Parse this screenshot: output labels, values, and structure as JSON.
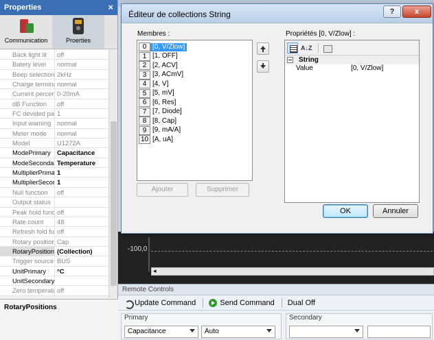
{
  "properties_panel": {
    "title": "Properties",
    "close_glyph": "×",
    "tabs": [
      {
        "label": "Communication",
        "icon": "communication-icon"
      },
      {
        "label": "Proerties",
        "icon": "multimeter-icon"
      }
    ],
    "rows": [
      {
        "key": "Back light lit",
        "value": "off"
      },
      {
        "key": "Batery level",
        "value": "normal"
      },
      {
        "key": "Beep selection",
        "value": "2kHz"
      },
      {
        "key": "Charge terminal",
        "value": "normal"
      },
      {
        "key": "Current percent",
        "value": "0-20mA"
      },
      {
        "key": "dB Function",
        "value": "off"
      },
      {
        "key": "FC devided pa",
        "value": "1"
      },
      {
        "key": "Input warning",
        "value": "normal"
      },
      {
        "key": "Meter mode",
        "value": "normal"
      },
      {
        "key": "Model",
        "value": "U1272A"
      },
      {
        "key": "ModePrimary",
        "value": "Capacitance"
      },
      {
        "key": "ModeSecondary",
        "value": "Temperature"
      },
      {
        "key": "MultiplierPrimary",
        "value": "1"
      },
      {
        "key": "MultiplierSecondary",
        "value": "1"
      },
      {
        "key": "Null function",
        "value": "off"
      },
      {
        "key": "Output status",
        "value": ""
      },
      {
        "key": "Peak hold func",
        "value": "off"
      },
      {
        "key": "Rate count",
        "value": "48"
      },
      {
        "key": "Refresh fold func",
        "value": "off"
      },
      {
        "key": "Rotary position",
        "value": "Cap"
      },
      {
        "key": "RotaryPositions",
        "value": "(Collection)"
      },
      {
        "key": "Trigger source",
        "value": "BUS"
      },
      {
        "key": "UnitPrimary",
        "value": "°C"
      },
      {
        "key": "UnitSecondary",
        "value": ""
      },
      {
        "key": "Zero temperature",
        "value": "off"
      }
    ],
    "description_title": "RotaryPositions"
  },
  "chart": {
    "axis_label": "-100,0",
    "secondary_label": "Secondary"
  },
  "remote_controls": {
    "header": "Remote Controls",
    "update_label": "Update Command",
    "send_label": "Send Command",
    "dual_off_label": "Dual Off",
    "primary_group": "Primary",
    "secondary_group": "Secondary",
    "primary_mode": "Capacitance",
    "primary_range": "Auto",
    "secondary_mode": "",
    "secondary_range": ""
  },
  "dialog": {
    "title": "Éditeur de collections String",
    "help_glyph": "?",
    "close_glyph": "x",
    "members_label": "Membres :",
    "members": [
      {
        "index": "0",
        "text": "[0, V/Zlow]"
      },
      {
        "index": "1",
        "text": "[1, OFF]"
      },
      {
        "index": "2",
        "text": "[2, ACV]"
      },
      {
        "index": "3",
        "text": "[3, ACmV]"
      },
      {
        "index": "4",
        "text": "[4, V]"
      },
      {
        "index": "5",
        "text": "[5, mV]"
      },
      {
        "index": "6",
        "text": "[6, Res]"
      },
      {
        "index": "7",
        "text": "[7, Diode]"
      },
      {
        "index": "8",
        "text": "[8, Cap]"
      },
      {
        "index": "9",
        "text": "[9, mA/A]"
      },
      {
        "index": "10",
        "text": "[A, uA]"
      }
    ],
    "add_label": "Ajouter",
    "remove_label": "Supprimer",
    "properties_label": "Propriétés [0, V/Zlow] :",
    "category": "String",
    "value_key": "Value",
    "value_val": "[0, V/Zlow]",
    "ok_label": "OK",
    "cancel_label": "Annuler"
  }
}
